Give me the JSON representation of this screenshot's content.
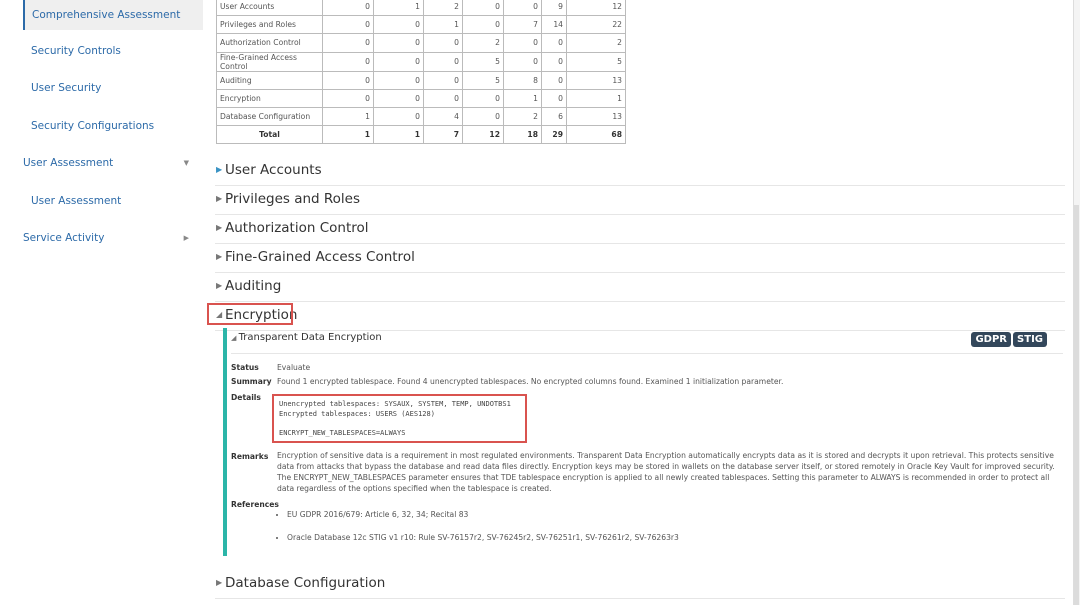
{
  "sidebar": {
    "items": [
      {
        "label": "Comprehensive Assessment"
      },
      {
        "label": "Security Controls"
      },
      {
        "label": "User Security"
      },
      {
        "label": "Security Configurations"
      },
      {
        "label": "User Assessment",
        "caret": "▼"
      },
      {
        "label": "User Assessment"
      },
      {
        "label": "Service Activity",
        "caret": "▶"
      }
    ]
  },
  "table": {
    "rows": [
      {
        "name": "User Accounts",
        "values": [
          "0",
          "1",
          "2",
          "0",
          "0",
          "9",
          "12"
        ]
      },
      {
        "name": "Privileges and Roles",
        "values": [
          "0",
          "0",
          "1",
          "0",
          "7",
          "14",
          "22"
        ]
      },
      {
        "name": "Authorization Control",
        "values": [
          "0",
          "0",
          "0",
          "2",
          "0",
          "0",
          "2"
        ]
      },
      {
        "name": "Fine-Grained Access Control",
        "values": [
          "0",
          "0",
          "0",
          "5",
          "0",
          "0",
          "5"
        ]
      },
      {
        "name": "Auditing",
        "values": [
          "0",
          "0",
          "0",
          "5",
          "8",
          "0",
          "13"
        ]
      },
      {
        "name": "Encryption",
        "values": [
          "0",
          "0",
          "0",
          "0",
          "1",
          "0",
          "1"
        ]
      },
      {
        "name": "Database Configuration",
        "values": [
          "1",
          "0",
          "4",
          "0",
          "2",
          "6",
          "13"
        ]
      },
      {
        "name": "Total",
        "values": [
          "1",
          "1",
          "7",
          "12",
          "18",
          "29",
          "68"
        ]
      }
    ]
  },
  "sections": [
    "User Accounts",
    "Privileges and Roles",
    "Authorization Control",
    "Fine-Grained Access Control",
    "Auditing",
    "Encryption",
    "Database Configuration"
  ],
  "finding": {
    "title": "Transparent Data Encryption",
    "badges": [
      "GDPR",
      "STIG"
    ],
    "status_label": "Status",
    "status": "Evaluate",
    "summary_label": "Summary",
    "summary": "Found 1 encrypted tablespace. Found 4 unencrypted tablespaces. No encrypted columns found. Examined 1 initialization parameter.",
    "details_label": "Details",
    "details": "Unencrypted tablespaces: SYSAUX, SYSTEM, TEMP, UNDOTBS1\nEncrypted tablespaces: USERS (AES128)\n\nENCRYPT_NEW_TABLESPACES=ALWAYS",
    "remarks_label": "Remarks",
    "remarks": "Encryption of sensitive data is a requirement in most regulated environments. Transparent Data Encryption automatically encrypts data as it is stored and decrypts it upon retrieval. This protects sensitive data from attacks that bypass the database and read data files directly. Encryption keys may be stored in wallets on the database server itself, or stored remotely in Oracle Key Vault for improved security. The ENCRYPT_NEW_TABLESPACES parameter ensures that TDE tablespace encryption is applied to all newly created tablespaces. Setting this parameter to ALWAYS is recommended in order to protect all data regardless of the options specified when the tablespace is created.",
    "references_label": "References",
    "references": [
      "EU GDPR 2016/679: Article 6, 32, 34; Recital 83",
      "Oracle Database 12c STIG v1 r10: Rule SV-76157r2, SV-76245r2, SV-76251r1, SV-76261r2, SV-76263r3"
    ]
  },
  "colors": {
    "accent": "#2c6aa8",
    "teal": "#2bb5a8",
    "highlight": "#d9534f",
    "badge": "#33475b"
  }
}
